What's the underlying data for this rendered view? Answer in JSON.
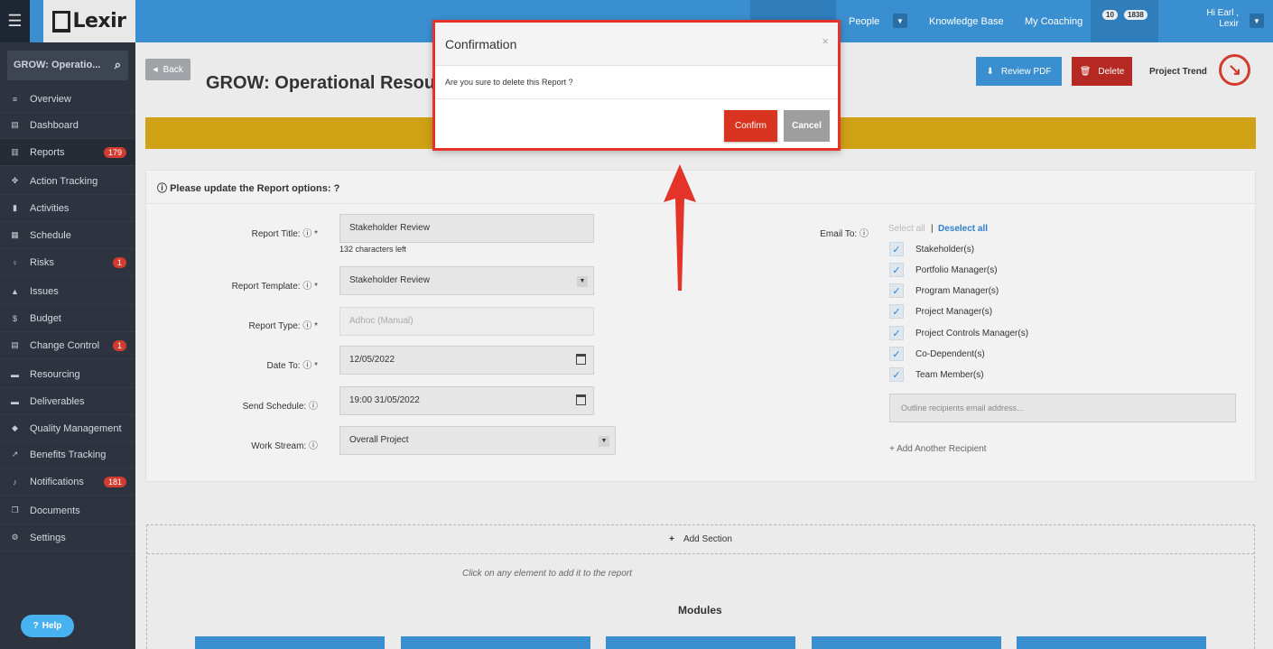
{
  "topbar": {
    "logo": "Lexir",
    "nav": [
      "People",
      "Knowledge Base",
      "My Coaching"
    ],
    "badges": [
      "10",
      "1838"
    ],
    "greeting_line1": "Hi Earl ,",
    "greeting_line2": "Lexir"
  },
  "sidebar": {
    "search_text": "GROW: Operatio...",
    "items": [
      {
        "label": "Overview",
        "icon": "list-icon"
      },
      {
        "label": "Dashboard",
        "icon": "dashboard-icon"
      },
      {
        "label": "Reports",
        "icon": "chart-icon",
        "badge": "179"
      },
      {
        "label": "Action Tracking",
        "icon": "crosshair-icon"
      },
      {
        "label": "Activities",
        "icon": "bookmark-icon"
      },
      {
        "label": "Schedule",
        "icon": "calendar-icon"
      },
      {
        "label": "Risks",
        "icon": "bulb-icon",
        "badge": "1"
      },
      {
        "label": "Issues",
        "icon": "warning-icon"
      },
      {
        "label": "Budget",
        "icon": "dollar-icon"
      },
      {
        "label": "Change Control",
        "icon": "stack-icon",
        "badge": "1"
      },
      {
        "label": "Resourcing",
        "icon": "folder-icon"
      },
      {
        "label": "Deliverables",
        "icon": "truck-icon"
      },
      {
        "label": "Quality Management",
        "icon": "tag-icon"
      },
      {
        "label": "Benefits Tracking",
        "icon": "trend-icon"
      },
      {
        "label": "Notifications",
        "icon": "bell-icon",
        "badge": "181"
      },
      {
        "label": "Documents",
        "icon": "documents-icon"
      },
      {
        "label": "Settings",
        "icon": "gears-icon"
      }
    ],
    "help": "Help"
  },
  "header": {
    "back": "Back",
    "title": "GROW: Operational Resour",
    "review_pdf": "Review PDF",
    "delete": "Delete",
    "project_trend": "Project Trend"
  },
  "form": {
    "heading": "Please update the Report options:",
    "title_label": "Report Title:",
    "title_value": "Stakeholder Review",
    "chars_left": "132 characters left",
    "template_label": "Report Template:",
    "template_value": "Stakeholder Review",
    "type_label": "Report Type:",
    "type_value": "Adhoc (Manual)",
    "date_label": "Date To:",
    "date_value": "12/05/2022",
    "schedule_label": "Send Schedule:",
    "schedule_value": "19:00 31/05/2022",
    "workstream_label": "Work Stream:",
    "workstream_value": "Overall Project",
    "email_label": "Email To:",
    "select_all": "Select all",
    "deselect_all": "Deselect all",
    "recipients": [
      "Stakeholder(s)",
      "Portfolio Manager(s)",
      "Program Manager(s)",
      "Project Manager(s)",
      "Project Controls Manager(s)",
      "Co-Dependent(s)",
      "Team Member(s)"
    ],
    "email_placeholder": "Outline recipients email address...",
    "add_recipient": "Add Another Recipient"
  },
  "sections": {
    "add_section": "Add Section",
    "hint": "Click on any element to add it to the report",
    "modules_title": "Modules"
  },
  "modal": {
    "title": "Confirmation",
    "message": "Are you sure to delete this Report ?",
    "confirm": "Confirm",
    "cancel": "Cancel"
  },
  "colors": {
    "topbar": "#3a8fd0",
    "sidebar": "#2d3440",
    "warning": "#cfa215",
    "danger": "#d8341f",
    "annotation": "#e4342a"
  }
}
